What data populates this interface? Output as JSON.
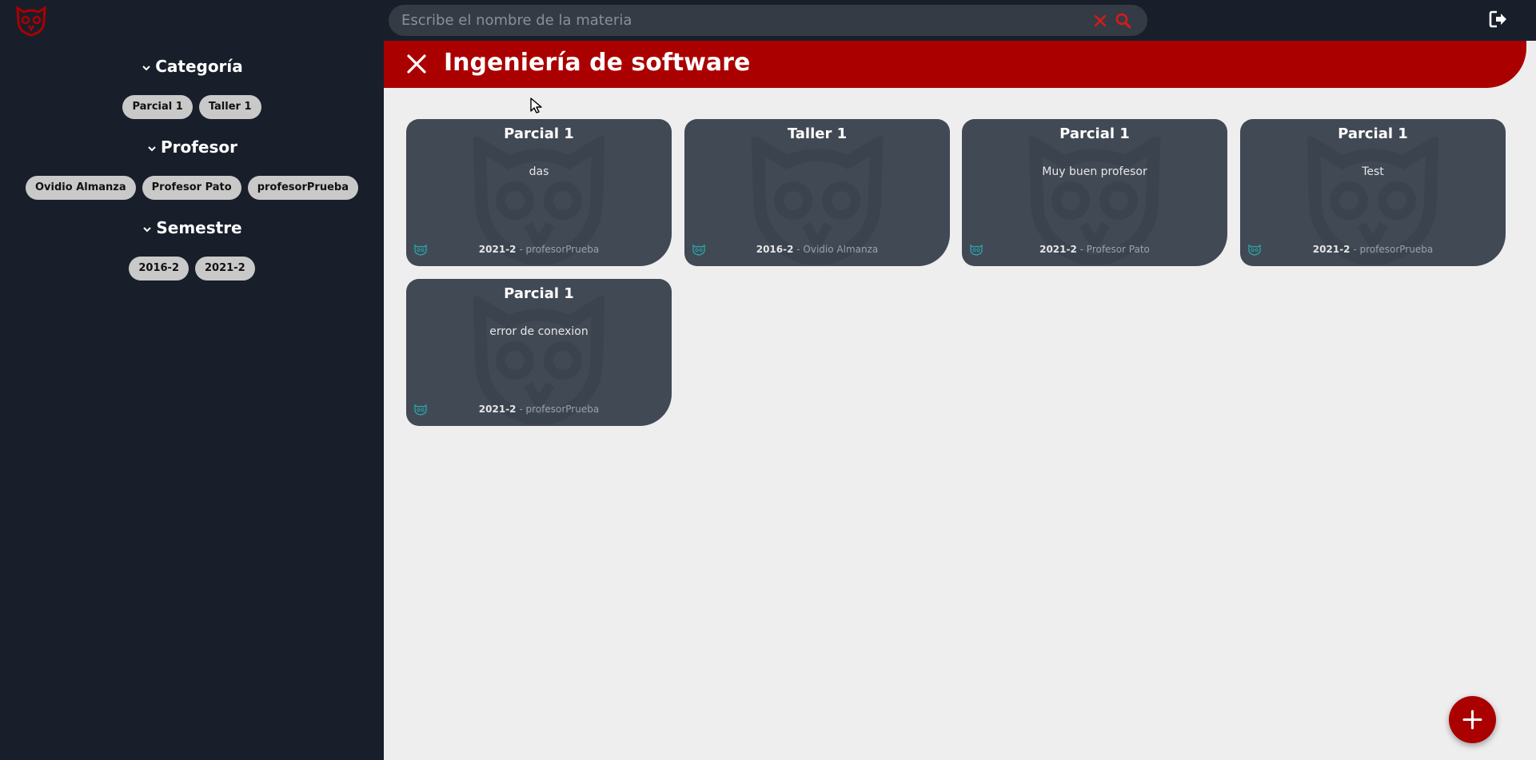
{
  "search": {
    "placeholder": "Escribe el nombre de la materia",
    "value": ""
  },
  "sidebar": {
    "filters": [
      {
        "title": "Categoría",
        "chips": [
          "Parcial 1",
          "Taller 1"
        ]
      },
      {
        "title": "Profesor",
        "chips": [
          "Ovidio Almanza",
          "Profesor Pato",
          "profesorPrueba"
        ]
      },
      {
        "title": "Semestre",
        "chips": [
          "2016-2",
          "2021-2"
        ]
      }
    ]
  },
  "main": {
    "title": "Ingeniería de software",
    "cards": [
      {
        "title": "Parcial 1",
        "description": "das",
        "semester": "2021-2",
        "separator": " - ",
        "professor": "profesorPrueba"
      },
      {
        "title": "Taller 1",
        "description": "",
        "semester": "2016-2",
        "separator": " - ",
        "professor": "Ovidio Almanza"
      },
      {
        "title": "Parcial 1",
        "description": "Muy buen profesor",
        "semester": "2021-2",
        "separator": " - ",
        "professor": "Profesor Pato"
      },
      {
        "title": "Parcial 1",
        "description": "Test",
        "semester": "2021-2",
        "separator": " - ",
        "professor": "profesorPrueba"
      },
      {
        "title": "Parcial 1",
        "description": "error de conexion",
        "semester": "2021-2",
        "separator": " - ",
        "professor": "profesorPrueba"
      }
    ]
  },
  "icons": {
    "logo": "owl-logo-icon",
    "clear": "close-icon",
    "search": "search-icon",
    "logout": "logout-icon",
    "header_close": "close-icon",
    "fab": "plus-icon",
    "card_badge": "owl-icon",
    "filter_toggle": "chevron-down-icon"
  },
  "colors": {
    "accent": "#aa0000",
    "sidebar_bg": "#181f2a",
    "main_bg": "#eeeeee",
    "card_bg": "#414955",
    "chip_bg": "#c9c9c9",
    "search_bg": "#343b45",
    "icon_red": "#cc1a1a",
    "card_badge": "#2aa3a3"
  }
}
